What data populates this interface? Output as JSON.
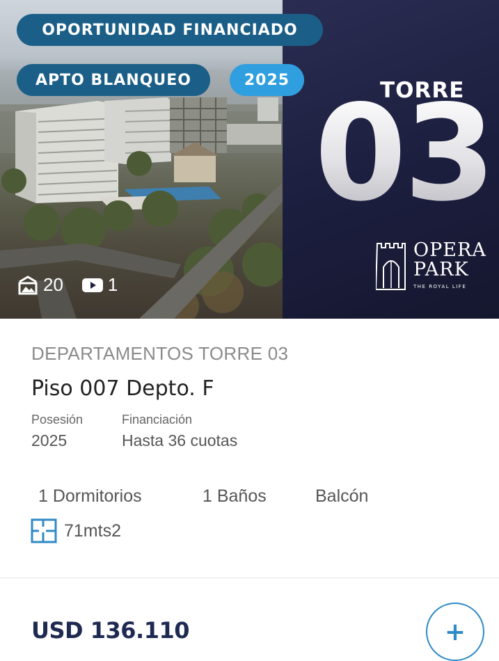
{
  "hero": {
    "badge_financiado": "OPORTUNIDAD FINANCIADO",
    "badge_blanqueo": "APTO BLANQUEO",
    "badge_year": "2025",
    "torre_label": "TORRE",
    "torre_number": "03",
    "logo_line1": "OPERA",
    "logo_line2": "PARK",
    "logo_tagline": "THE ROYAL LIFE",
    "photo_count": "20",
    "video_count": "1",
    "icons": {
      "photos": "photo-gallery-icon",
      "videos": "video-play-icon"
    }
  },
  "listing": {
    "section_title": "DEPARTAMENTOS TORRE 03",
    "unit_title": "Piso 007 Depto. F",
    "posesion_label": "Posesión",
    "posesion_value": "2025",
    "financiacion_label": "Financiación",
    "financiacion_value": "Hasta 36 cuotas",
    "features": {
      "bedrooms": "1 Dormitorios",
      "bathrooms": "1 Baños",
      "balcony": "Balcón"
    },
    "area": "71mts2",
    "area_icon": "floor-plan-icon",
    "price": "USD 136.110",
    "add_icon": "plus-icon"
  },
  "colors": {
    "badge_dark": "#1b5f88",
    "badge_light": "#2f9fe0",
    "panel": "#1c1e3e",
    "price": "#1f2a52",
    "accent": "#2f8ac6"
  }
}
